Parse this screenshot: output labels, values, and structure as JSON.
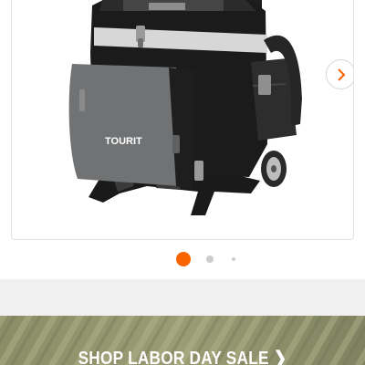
{
  "product": {
    "brand_label": "TOURIT",
    "next_arrow_icon": "chevron-right-icon"
  },
  "carousel": {
    "slides": 3,
    "active_index": 0,
    "active_color": "#f96302",
    "inactive_color": "#cccccc"
  },
  "promo": {
    "label": "SHOP LABOR DAY SALE",
    "arrow": "❯",
    "text_color": "#ffffff"
  }
}
